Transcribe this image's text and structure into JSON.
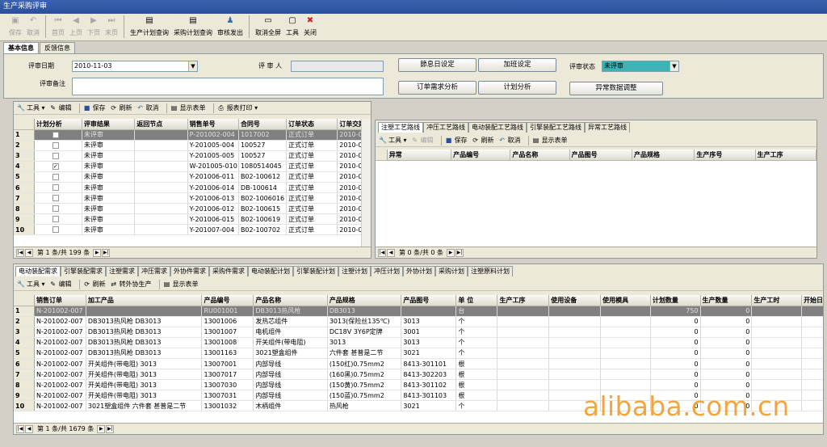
{
  "window": {
    "title": "生产采购评审"
  },
  "toolbar": {
    "items": [
      {
        "label": "保存",
        "icon": "save-icon",
        "disabled": true
      },
      {
        "label": "取消",
        "icon": "cancel-icon",
        "disabled": true
      },
      {
        "label": "首页",
        "icon": "first-page-icon",
        "disabled": true
      },
      {
        "label": "上页",
        "icon": "prev-page-icon",
        "disabled": true
      },
      {
        "label": "下页",
        "icon": "next-page-icon",
        "disabled": true
      },
      {
        "label": "末页",
        "icon": "last-page-icon",
        "disabled": true
      },
      {
        "label": "生产计划查询",
        "icon": "document-icon",
        "disabled": false
      },
      {
        "label": "采购计划查询",
        "icon": "document-icon",
        "disabled": false
      },
      {
        "label": "审核发出",
        "icon": "user-icon",
        "disabled": false
      },
      {
        "label": "取消全屏",
        "icon": "window-icon",
        "disabled": false
      },
      {
        "label": "工具",
        "icon": "tools-icon",
        "disabled": false
      },
      {
        "label": "关闭",
        "icon": "close-icon",
        "disabled": false
      }
    ]
  },
  "top_tabs": [
    "基本信息",
    "反馈信息"
  ],
  "form": {
    "review_date_label": "评审日期",
    "review_date_value": "2010-11-03",
    "reviewer_label": "评 审 人",
    "reviewer_value": "",
    "review_note_label": "评审备注",
    "review_note_value": "",
    "status_label": "评审状态",
    "status_value": "未评审",
    "btn_holiday": "節息日设定",
    "btn_overtime": "加班设定",
    "btn_order_analysis": "订单需求分析",
    "btn_plan_analysis": "计划分析",
    "btn_exception": "异常数据调整"
  },
  "left_toolbar": {
    "tools": "工具",
    "edit": "编辑",
    "save": "保存",
    "refresh": "刷新",
    "cancel": "取消",
    "show_form": "显示表单",
    "print": "报表打印"
  },
  "left_grid": {
    "columns": [
      "计划分析",
      "评审结果",
      "返回节点",
      "销售单号",
      "合同号",
      "订单状态",
      "订单交期"
    ],
    "rows": [
      {
        "n": "1",
        "checked": false,
        "result": "未评审",
        "node": "",
        "order": "P-201002-004",
        "contract": "1017002",
        "status": "正式订单",
        "date": "2010-04-1"
      },
      {
        "n": "2",
        "checked": false,
        "result": "未评审",
        "node": "",
        "order": "Y-201005-004",
        "contract": "100527",
        "status": "正式订单",
        "date": "2010-06-0"
      },
      {
        "n": "3",
        "checked": false,
        "result": "未评审",
        "node": "",
        "order": "Y-201005-005",
        "contract": "100527",
        "status": "正式订单",
        "date": "2010-06-0"
      },
      {
        "n": "4",
        "checked": true,
        "result": "未评审",
        "node": "",
        "order": "W-201005-010",
        "contract": "1080514045",
        "status": "正式订单",
        "date": "2010-06-1"
      },
      {
        "n": "5",
        "checked": false,
        "result": "未评审",
        "node": "",
        "order": "Y-201006-011",
        "contract": "B02-100612",
        "status": "正式订单",
        "date": "2010-06-2"
      },
      {
        "n": "6",
        "checked": false,
        "result": "未评审",
        "node": "",
        "order": "Y-201006-014",
        "contract": "DB-100614",
        "status": "正式订单",
        "date": "2010-06-2"
      },
      {
        "n": "7",
        "checked": false,
        "result": "未评审",
        "node": "",
        "order": "Y-201006-013",
        "contract": "B02-1006016",
        "status": "正式订单",
        "date": "2010-06-2"
      },
      {
        "n": "8",
        "checked": false,
        "result": "未评审",
        "node": "",
        "order": "Y-201006-012",
        "contract": "B02-100615",
        "status": "正式订单",
        "date": "2010-06-3"
      },
      {
        "n": "9",
        "checked": false,
        "result": "未评审",
        "node": "",
        "order": "Y-201006-015",
        "contract": "B02-100619",
        "status": "正式订单",
        "date": "2010-07-0"
      },
      {
        "n": "10",
        "checked": false,
        "result": "未评审",
        "node": "",
        "order": "Y-201007-004",
        "contract": "B02-100702",
        "status": "正式订单",
        "date": "2010-07-0"
      }
    ],
    "pager": "第 1 条/共 199 条"
  },
  "right_panel": {
    "tabs": [
      "注塑工艺路线",
      "冲压工艺路线",
      "电动装配工艺路线",
      "引擎装配工艺路线",
      "异常工艺路线"
    ],
    "toolbar": {
      "tools": "工具",
      "edit": "编辑",
      "save": "保存",
      "refresh": "刷新",
      "cancel": "取消",
      "show_form": "显示表单"
    },
    "columns": [
      "异常",
      "产品编号",
      "产品名称",
      "产品图号",
      "产品规格",
      "生产序号",
      "生产工序"
    ],
    "pager": "第 0 条/共 0 条"
  },
  "bottom_panel": {
    "tabs": [
      "电动装配需求",
      "引擎装配需求",
      "注塑需求",
      "冲压需求",
      "外协件需求",
      "采购件需求",
      "电动装配计划",
      "引擎装配计划",
      "注塑计划",
      "冲压计划",
      "外协计划",
      "采购计划",
      "注塑原料计划"
    ],
    "toolbar": {
      "tools": "工具",
      "edit": "编辑",
      "refresh": "刷新",
      "transfer": "转外协生产",
      "show_form": "显示表单"
    },
    "columns": [
      "销售订单",
      "加工产品",
      "产品编号",
      "产品名称",
      "产品规格",
      "产品图号",
      "单 位",
      "生产工序",
      "使用设备",
      "使用模具",
      "计划数量",
      "生产数量",
      "生产工时",
      "开始日期"
    ],
    "rows": [
      {
        "n": "1",
        "order": "N-201002-007",
        "product": "",
        "code": "RU001001",
        "name": "DB3013热风枪",
        "spec": "DB3013",
        "drawing": "",
        "unit": "台",
        "process": "",
        "equip": "",
        "mold": "",
        "plan": "750",
        "prod": "0",
        "hours": "",
        "start": ""
      },
      {
        "n": "2",
        "order": "N-201002-007",
        "product": "DB3013热风枪 DB3013",
        "code": "13001006",
        "name": "发热芯组件",
        "spec": "3013(保险丝135℃)",
        "drawing": "3013",
        "unit": "个",
        "process": "",
        "equip": "",
        "mold": "",
        "plan": "0",
        "prod": "0",
        "hours": "",
        "start": ""
      },
      {
        "n": "3",
        "order": "N-201002-007",
        "product": "DB3013热风枪 DB3013",
        "code": "13001007",
        "name": "电机组件",
        "spec": "DC18V 3Y6P定牌",
        "drawing": "3001",
        "unit": "个",
        "process": "",
        "equip": "",
        "mold": "",
        "plan": "0",
        "prod": "0",
        "hours": "",
        "start": ""
      },
      {
        "n": "4",
        "order": "N-201002-007",
        "product": "DB3013热风枪 DB3013",
        "code": "13001008",
        "name": "开关组件(带电阻)",
        "spec": "3013",
        "drawing": "3013",
        "unit": "个",
        "process": "",
        "equip": "",
        "mold": "",
        "plan": "0",
        "prod": "0",
        "hours": "",
        "start": ""
      },
      {
        "n": "5",
        "order": "N-201002-007",
        "product": "DB3013热风枪 DB3013",
        "code": "13001163",
        "name": "3021塑盒组件",
        "spec": "六件套 甚普是二节",
        "drawing": "3021",
        "unit": "个",
        "process": "",
        "equip": "",
        "mold": "",
        "plan": "0",
        "prod": "0",
        "hours": "",
        "start": ""
      },
      {
        "n": "6",
        "order": "N-201002-007",
        "product": "开关组件(带电阻) 3013",
        "code": "13007001",
        "name": "内部导线",
        "spec": "(150红)0.75mm2",
        "drawing": "8413-301101",
        "unit": "根",
        "process": "",
        "equip": "",
        "mold": "",
        "plan": "0",
        "prod": "0",
        "hours": "",
        "start": ""
      },
      {
        "n": "7",
        "order": "N-201002-007",
        "product": "开关组件(带电阻) 3013",
        "code": "13007017",
        "name": "内部导线",
        "spec": "(160黑)0.75mm2",
        "drawing": "8413-302203",
        "unit": "根",
        "process": "",
        "equip": "",
        "mold": "",
        "plan": "0",
        "prod": "0",
        "hours": "",
        "start": ""
      },
      {
        "n": "8",
        "order": "N-201002-007",
        "product": "开关组件(带电阻) 3013",
        "code": "13007030",
        "name": "内部导线",
        "spec": "(150黄)0.75mm2",
        "drawing": "8413-301102",
        "unit": "根",
        "process": "",
        "equip": "",
        "mold": "",
        "plan": "0",
        "prod": "0",
        "hours": "",
        "start": ""
      },
      {
        "n": "9",
        "order": "N-201002-007",
        "product": "开关组件(带电阻) 3013",
        "code": "13007031",
        "name": "内部导线",
        "spec": "(150蓝)0.75mm2",
        "drawing": "8413-301103",
        "unit": "根",
        "process": "",
        "equip": "",
        "mold": "",
        "plan": "0",
        "prod": "0",
        "hours": "",
        "start": ""
      },
      {
        "n": "10",
        "order": "N-201002-007",
        "product": "3021塑盒组件 六件套 甚普是二节",
        "code": "13001032",
        "name": "木柄组件",
        "spec": "热风枪",
        "drawing": "3021",
        "unit": "个",
        "process": "",
        "equip": "",
        "mold": "",
        "plan": "0",
        "prod": "0",
        "hours": "",
        "start": ""
      }
    ],
    "pager": "第 1 条/共 1679 条"
  },
  "watermark": "alibaba.com.cn",
  "colors": {
    "titlebar": "#2a4f9a",
    "selected_row": "#808080",
    "status_field": "#3cb4b4",
    "watermark": "#f0a030"
  }
}
